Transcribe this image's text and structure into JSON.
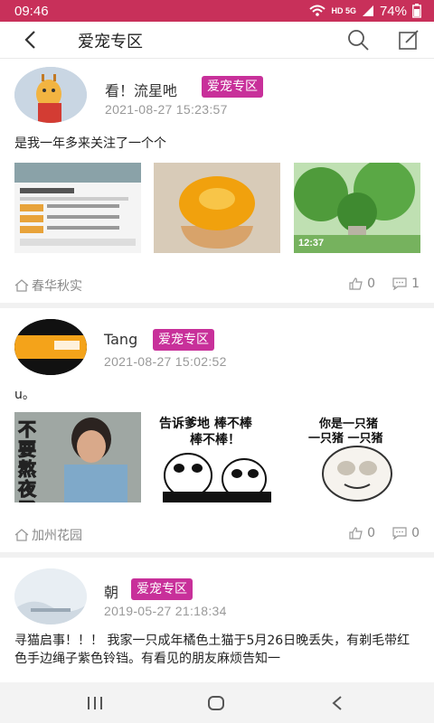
{
  "status": {
    "time": "09:46",
    "network": "HD 5G",
    "battery": "74%"
  },
  "header": {
    "title": "爱宠专区"
  },
  "posts": [
    {
      "username": "看！流星吔",
      "tag": "爱宠专区",
      "date": "2021-08-27 15:23:57",
      "text": "是我一年多来关注了一个个",
      "location": "春华秋实",
      "likes": "0",
      "comments": "1",
      "image2_caption": "12:37"
    },
    {
      "username": "Tang",
      "tag": "爱宠专区",
      "date": "2021-08-27 15:02:52",
      "text": "u。",
      "location": "加州花园",
      "likes": "0",
      "comments": "0",
      "meme1": "不要熬夜了",
      "meme2_line1": "告诉爹地 棒不棒",
      "meme2_line2": "棒不棒！",
      "meme3_line1": "你是一只猪",
      "meme3_line2": "一只猪 一只猪"
    },
    {
      "username": "朝",
      "tag": "爱宠专区",
      "date": "2019-05-27 21:18:34",
      "text": "寻猫启事！！！ 我家一只成年橘色土猫于5月26日晚丢失，有剃毛带红色手边绳子紫色铃铛。有看见的朋友麻烦告知一"
    }
  ],
  "colors": {
    "accent": "#c8305a",
    "tag": "#c8309a"
  }
}
